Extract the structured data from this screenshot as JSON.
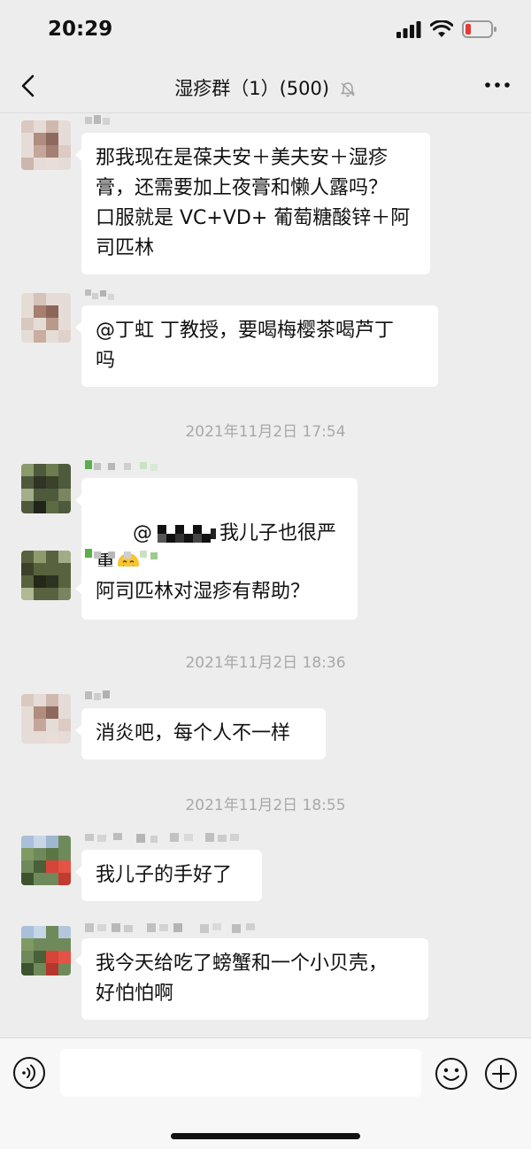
{
  "status": {
    "time": "20:29"
  },
  "nav": {
    "title": "湿疹群（1）(500)"
  },
  "messages": [
    {
      "text": "那我现在是葆夫安＋美夫安＋湿疹\n膏，还需要加上夜膏和懒人露吗？\n口服就是 VC+VD+ 葡萄糖酸锌＋阿\n司匹林"
    },
    {
      "text": "@丁虹 丁教授，要喝梅樱茶喝芦丁\n吗"
    },
    {
      "prefix": "@",
      "suffix": "我儿子也很严重",
      "emoji": "😢"
    },
    {
      "text": "阿司匹林对湿疹有帮助？"
    },
    {
      "text": "消炎吧，每个人不一样"
    },
    {
      "text": "我儿子的手好了"
    },
    {
      "text": "我今天给吃了螃蟹和一个小贝壳，\n好怕怕啊"
    }
  ],
  "timestamps": [
    "2021年11月2日 17:54",
    "2021年11月2日 18:36",
    "2021年11月2日 18:55"
  ],
  "input": {
    "value": "",
    "placeholder": ""
  },
  "icons": {
    "back": "back-chevron-icon",
    "mute": "bell-muted-icon",
    "more": "more-dots-icon",
    "voice": "voice-icon",
    "emoji": "emoji-icon",
    "plus": "plus-icon"
  }
}
